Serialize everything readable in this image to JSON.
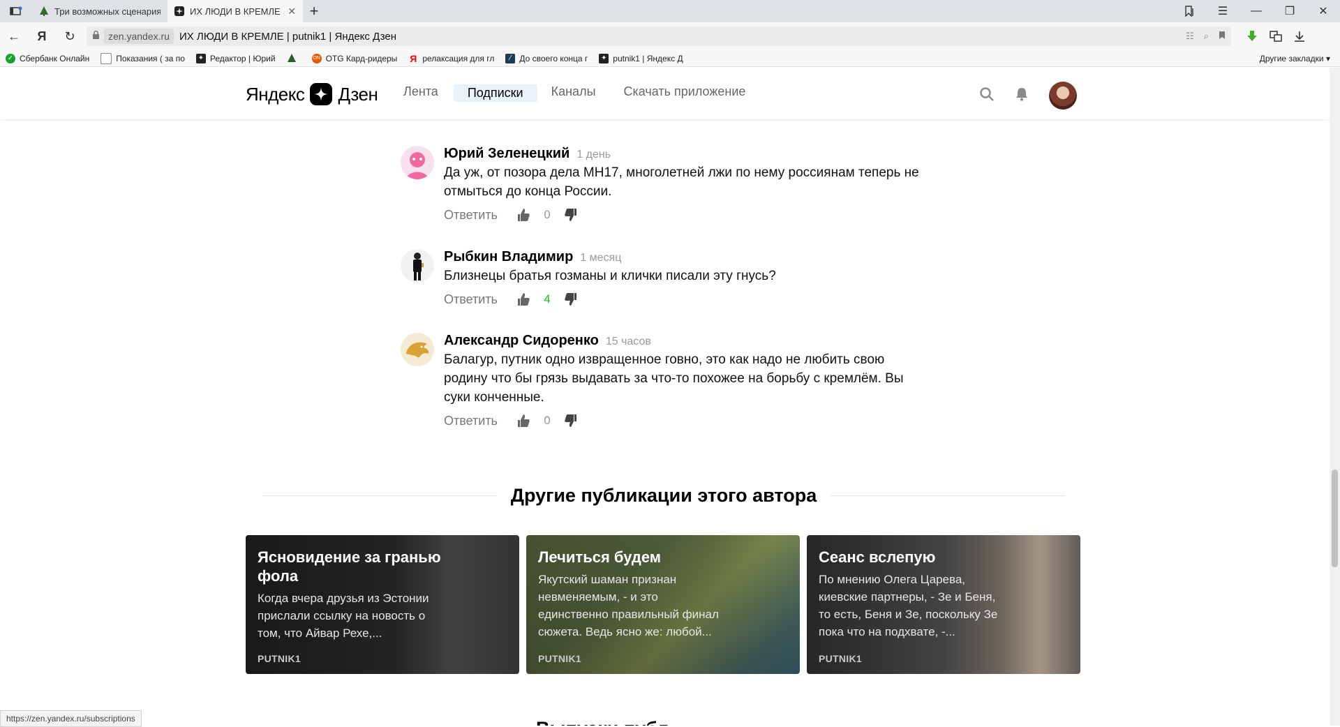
{
  "browser": {
    "tabs": [
      {
        "title": "Три возможных сценария",
        "active": false
      },
      {
        "title": "ИХ ЛЮДИ В КРЕМЛЕ | p",
        "active": true
      }
    ],
    "url_domain": "zen.yandex.ru",
    "url_title": "ИХ ЛЮДИ В КРЕМЛЕ | putnik1 | Яндекс Дзен",
    "bookmarks": [
      {
        "label": "Сбербанк Онлайн",
        "color": "#1a9f29"
      },
      {
        "label": "Показания ( за по",
        "color": "#ffffff"
      },
      {
        "label": "Редактор | Юрий",
        "color": "#222222"
      },
      {
        "label": "",
        "color": "#2b5f2b"
      },
      {
        "label": "OTG Кард-ридеры",
        "color": "#e85a00"
      },
      {
        "label": "релаксация для гл",
        "color": "#ff0000"
      },
      {
        "label": "До своего конца г",
        "color": "#1f3b57"
      },
      {
        "label": "putnik1 | Яндекс Д",
        "color": "#222222"
      }
    ],
    "bookmarks_more": "Другие закладки"
  },
  "header": {
    "logo_left": "Яндекс",
    "logo_right": "Дзен",
    "nav": [
      "Лента",
      "Подписки",
      "Каналы",
      "Скачать приложение"
    ],
    "active_nav": "Подписки"
  },
  "comments": [
    {
      "name": "Юрий Зеленецкий",
      "time": "1 день",
      "text": "Да уж, от позора дела МН17, многолетней лжи по нему россиянам теперь не отмыться до конца России.",
      "reply": "Ответить",
      "likes": "0",
      "avatar_color": "#f06aa0"
    },
    {
      "name": "Рыбкин Владимир",
      "time": "1 месяц",
      "text": "Близнецы братья гозманы и клички писали эту гнусь?",
      "reply": "Ответить",
      "likes": "4",
      "avatar_color": "#f2f2f2"
    },
    {
      "name": "Александр Сидоренко",
      "time": "15 часов",
      "text": "Балагур, путник одно извращенное говно, это как надо не любить свою родину что бы грязь выдавать за что-то похожее на борьбу с кремлём. Вы суки конченные.",
      "reply": "Ответить",
      "likes": "0",
      "avatar_color": "#d8a234"
    }
  ],
  "section": {
    "title": "Другие публикации этого автора",
    "next_title": "Выпуски публ"
  },
  "cards": [
    {
      "title": "Ясновидение за гранью фола",
      "snippet": "Когда вчера друзья из Эстонии прислали ссылку на новость о том, что Айвар Рехе,...",
      "author": "PUTNIK1"
    },
    {
      "title": "Лечиться будем",
      "snippet": "Якутский шаман признан невменяемым, - и это единственно правильный финал сюжета. Ведь ясно же: любой...",
      "author": "PUTNIK1"
    },
    {
      "title": "Сеанс вслепую",
      "snippet": "По мнению Олега Царева, киевские партнеры, - Зе и Беня, то есть, Беня и Зе, поскольку Зе пока что на подхвате, -...",
      "author": "PUTNIK1"
    }
  ],
  "status_url": "https://zen.yandex.ru/subscriptions"
}
